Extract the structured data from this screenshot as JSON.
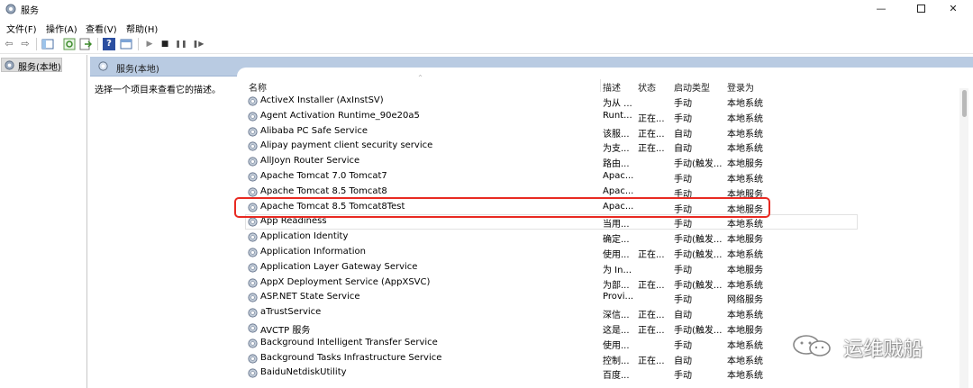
{
  "window": {
    "title": "服务",
    "minimize": "—",
    "close": "✕"
  },
  "menu": [
    "文件(F)",
    "操作(A)",
    "查看(V)",
    "帮助(H)"
  ],
  "toolbar": {
    "icons": [
      "back-icon",
      "forward-icon",
      "show-hide-tree-icon",
      "refresh-icon",
      "export-list-icon",
      "help-icon",
      "properties-icon",
      "start-service-icon",
      "stop-service-icon",
      "pause-service-icon",
      "restart-service-icon"
    ],
    "glyphs": {
      "back": "⇦",
      "forward": "⇨",
      "start": "▶",
      "stop": "■",
      "pause": "❚❚",
      "restart": "❚▶",
      "help": "?"
    }
  },
  "tree": {
    "root_label": "服务(本地)"
  },
  "content": {
    "header": "服务(本地)",
    "description_prompt": "选择一个项目来查看它的描述。"
  },
  "columns": {
    "name": "名称",
    "desc": "描述",
    "status": "状态",
    "start": "启动类型",
    "logon": "登录为"
  },
  "services": [
    {
      "name": "ActiveX Installer (AxInstSV)",
      "desc": "为从 ...",
      "status": "",
      "start": "手动",
      "logon": "本地系统"
    },
    {
      "name": "Agent Activation Runtime_90e20a5",
      "desc": "Runt...",
      "status": "正在...",
      "start": "手动",
      "logon": "本地系统"
    },
    {
      "name": "Alibaba PC Safe Service",
      "desc": "该服...",
      "status": "正在...",
      "start": "自动",
      "logon": "本地系统"
    },
    {
      "name": "Alipay payment client security service",
      "desc": "为支...",
      "status": "正在...",
      "start": "自动",
      "logon": "本地系统"
    },
    {
      "name": "AllJoyn Router Service",
      "desc": "路由...",
      "status": "",
      "start": "手动(触发...",
      "logon": "本地服务"
    },
    {
      "name": "Apache Tomcat 7.0 Tomcat7",
      "desc": "Apac...",
      "status": "",
      "start": "手动",
      "logon": "本地系统"
    },
    {
      "name": "Apache Tomcat 8.5 Tomcat8",
      "desc": "Apac...",
      "status": "",
      "start": "手动",
      "logon": "本地服务"
    },
    {
      "name": "Apache Tomcat 8.5 Tomcat8Test",
      "desc": "Apac...",
      "status": "",
      "start": "手动",
      "logon": "本地服务"
    },
    {
      "name": "App Readiness",
      "desc": "当用...",
      "status": "",
      "start": "手动",
      "logon": "本地系统"
    },
    {
      "name": "Application Identity",
      "desc": "确定...",
      "status": "",
      "start": "手动(触发...",
      "logon": "本地服务"
    },
    {
      "name": "Application Information",
      "desc": "使用...",
      "status": "正在...",
      "start": "手动(触发...",
      "logon": "本地系统"
    },
    {
      "name": "Application Layer Gateway Service",
      "desc": "为 In...",
      "status": "",
      "start": "手动",
      "logon": "本地服务"
    },
    {
      "name": "AppX Deployment Service (AppXSVC)",
      "desc": "为部...",
      "status": "正在...",
      "start": "手动(触发...",
      "logon": "本地系统"
    },
    {
      "name": "ASP.NET State Service",
      "desc": "Provi...",
      "status": "",
      "start": "手动",
      "logon": "网络服务"
    },
    {
      "name": "aTrustService",
      "desc": "深信...",
      "status": "正在...",
      "start": "自动",
      "logon": "本地系统"
    },
    {
      "name": "AVCTP 服务",
      "desc": "这是...",
      "status": "正在...",
      "start": "手动(触发...",
      "logon": "本地服务"
    },
    {
      "name": "Background Intelligent Transfer Service",
      "desc": "使用...",
      "status": "",
      "start": "手动",
      "logon": "本地系统"
    },
    {
      "name": "Background Tasks Infrastructure Service",
      "desc": "控制...",
      "status": "正在...",
      "start": "自动",
      "logon": "本地系统"
    },
    {
      "name": "BaiduNetdiskUtility",
      "desc": "百度...",
      "status": "",
      "start": "手动",
      "logon": "本地系统"
    }
  ],
  "watermark": {
    "text": "运维贼船"
  }
}
